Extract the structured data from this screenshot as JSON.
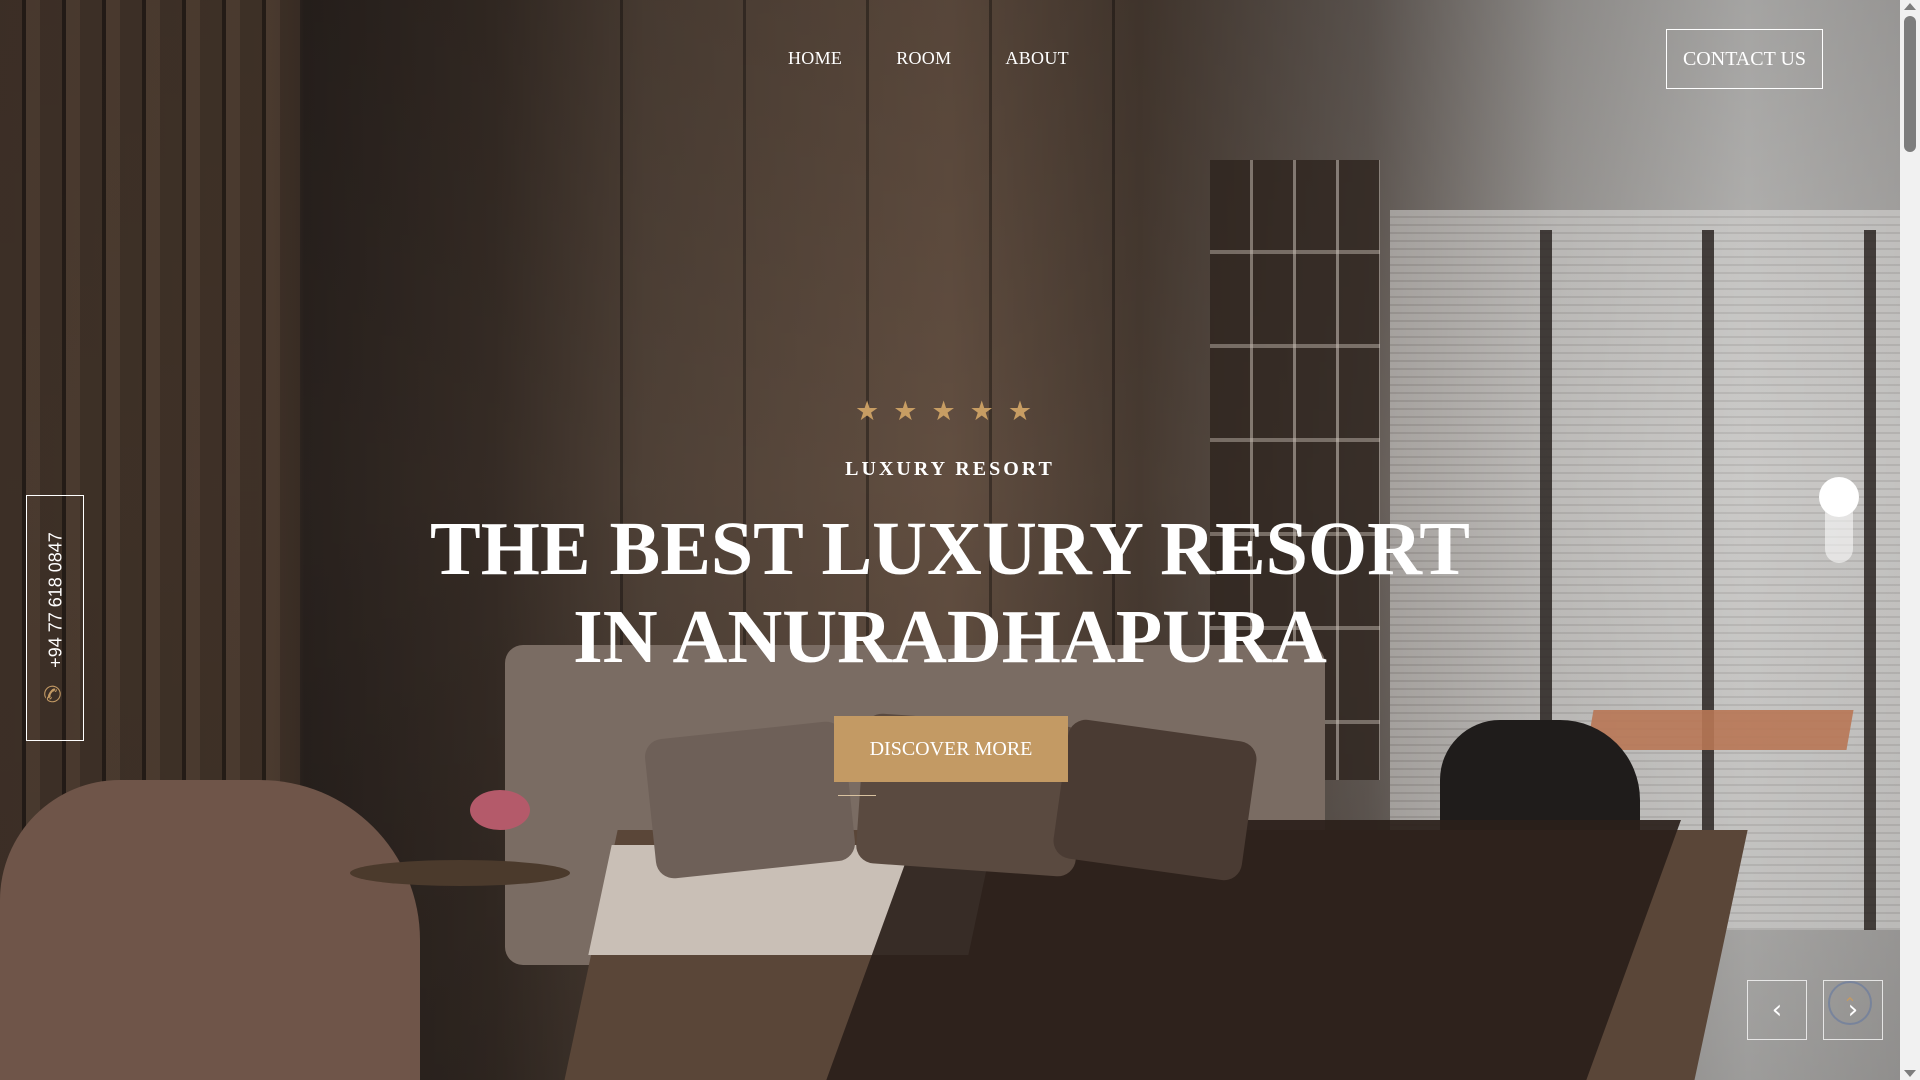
{
  "nav": {
    "items": [
      {
        "label": "HOME"
      },
      {
        "label": "ROOM"
      },
      {
        "label": "ABOUT"
      }
    ],
    "contact_label": "CONTACT US"
  },
  "hero": {
    "rating_stars": 5,
    "eyebrow": "LUXURY RESORT",
    "headline_line1": "THE BEST LUXURY RESORT",
    "headline_line2": "IN ANURADHAPURA",
    "cta_label": "DISCOVER MORE"
  },
  "side": {
    "phone": "+94 77 618 0847"
  },
  "slider": {
    "prev_icon": "‹",
    "next_icon": "›"
  },
  "colors": {
    "accent_gold": "#c39a64",
    "star": "#c79d63",
    "text": "#ffffff"
  },
  "icons": [
    "star-icon",
    "phone-icon",
    "chevron-left-icon",
    "chevron-right-icon",
    "chevron-up-icon"
  ]
}
